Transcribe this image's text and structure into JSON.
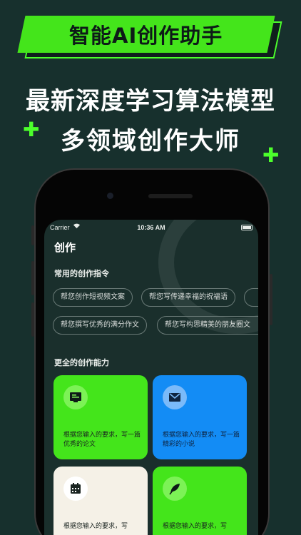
{
  "banner": {
    "text": "智能AI创作助手"
  },
  "headline": {
    "line1": "最新深度学习算法模型",
    "line2": "多领域创作大师"
  },
  "status_bar": {
    "carrier": "Carrier",
    "time": "10:36 AM"
  },
  "page": {
    "title": "创作"
  },
  "common_prompts": {
    "heading": "常用的创作指令",
    "chips": [
      "帮您创作短视频文案",
      "帮您写传递幸福的祝福语",
      "",
      "帮您撰写优秀的满分作文",
      "帮您写构思精美的朋友圈文"
    ]
  },
  "capabilities": {
    "heading": "更全的创作能力",
    "cards": [
      {
        "text": "根据您输入的要求，写一篇优秀的论文",
        "icon": "paper-icon"
      },
      {
        "text": "根据您输入的要求，写一篇精彩的小说",
        "icon": "mail-icon"
      },
      {
        "text": "根据您输入的要求，写",
        "icon": "calendar-icon"
      },
      {
        "text": "根据您输入的要求，写",
        "icon": "feather-icon"
      }
    ]
  },
  "colors": {
    "background": "#17302d",
    "accent_green": "#44e51b",
    "accent_blue": "#138cf5",
    "cream": "#f5f1e7"
  }
}
